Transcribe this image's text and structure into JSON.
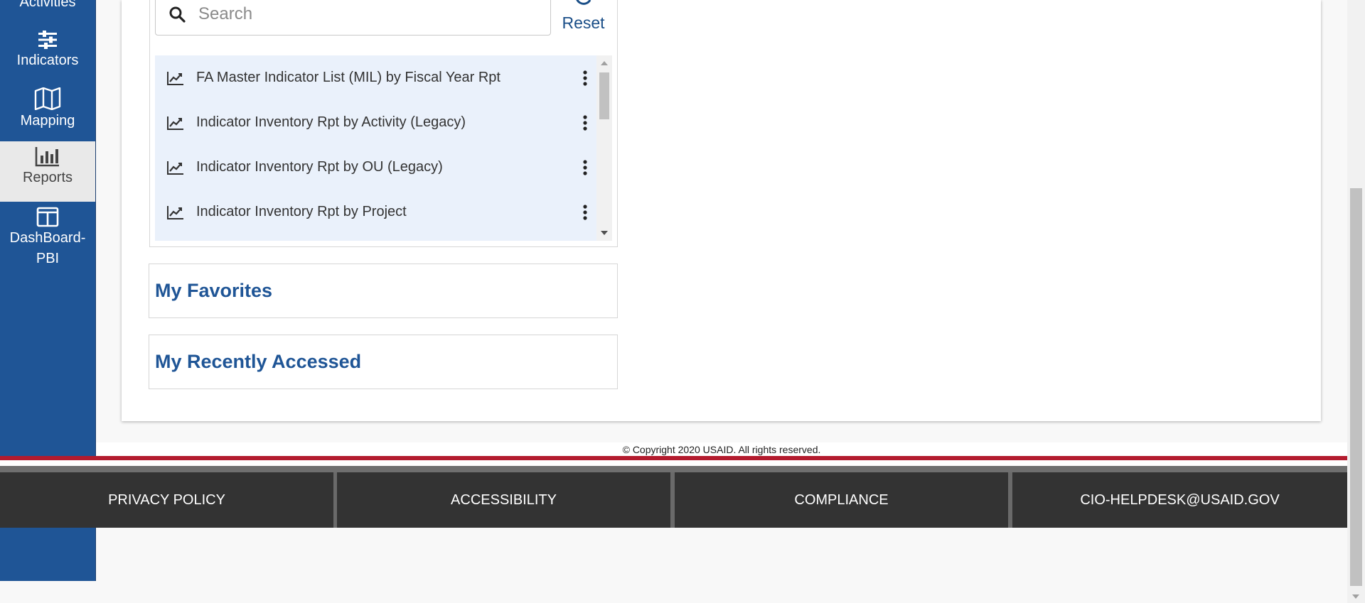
{
  "sidebar": {
    "items": [
      {
        "label": "Activities",
        "icon": "activities-icon"
      },
      {
        "label": "Indicators",
        "icon": "sliders-icon"
      },
      {
        "label": "Mapping",
        "icon": "map-icon"
      },
      {
        "label": "Reports",
        "icon": "bar-chart-icon",
        "active": true
      },
      {
        "label": "DashBoard-PBI",
        "label_line1": "DashBoard-",
        "label_line2": "PBI",
        "icon": "dashboard-icon"
      }
    ]
  },
  "search": {
    "placeholder": "Search",
    "value": ""
  },
  "reset": {
    "label": "Reset"
  },
  "reports": [
    {
      "label": "FA Master Indicator List (MIL) by Fiscal Year Rpt"
    },
    {
      "label": "Indicator Inventory Rpt by Activity (Legacy)"
    },
    {
      "label": "Indicator Inventory Rpt by OU (Legacy)"
    },
    {
      "label": "Indicator Inventory Rpt by Project"
    }
  ],
  "sections": {
    "favorites": "My Favorites",
    "recent": "My Recently Accessed"
  },
  "footer": {
    "copyright": "© Copyright 2020 USAID. All rights reserved.",
    "links": [
      "PRIVACY POLICY",
      "ACCESSIBILITY",
      "COMPLIANCE",
      "CIO-HELPDESK@USAID.GOV"
    ]
  },
  "colors": {
    "sidebar": "#1f5596",
    "accent": "#1b4f88",
    "list_bg": "#eaf1fb",
    "footer_bg": "#333333",
    "footer_rule": "#b31b2e"
  }
}
